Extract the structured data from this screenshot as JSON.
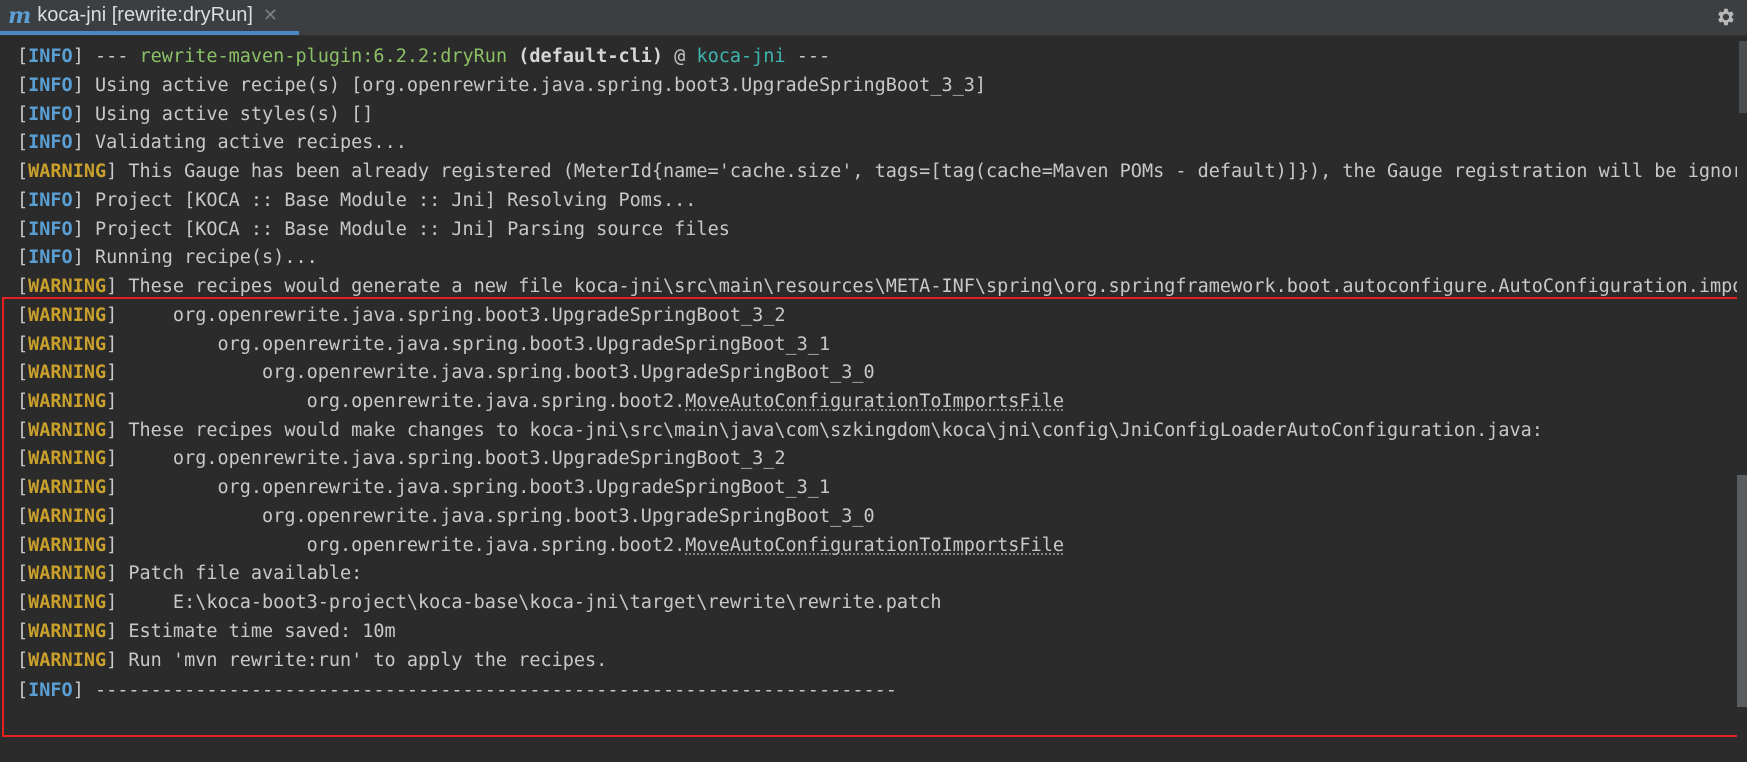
{
  "tab": {
    "logo": "m",
    "label": "koca-jni [rewrite:dryRun]",
    "close": "✕"
  },
  "toolbar": {
    "settings_icon": "gear-icon"
  },
  "console": {
    "l0": {
      "pre": "] --- ",
      "plugin": "rewrite-maven-plugin:6.2.2:dryRun",
      "mid": " ",
      "goal": "(default-cli)",
      "at": " @ ",
      "project": "koca-jni",
      "post": " ---"
    },
    "l1": "] Using active recipe(s) [org.openrewrite.java.spring.boot3.UpgradeSpringBoot_3_3]",
    "l2": "] Using active styles(s) []",
    "l3": "] Validating active recipes...",
    "l4": "] This Gauge has been already registered (MeterId{name='cache.size', tags=[tag(cache=Maven POMs - default)]}), the Gauge registration will be ignored.",
    "l5": "] Project [KOCA :: Base Module :: Jni] Resolving Poms...",
    "l6": "] Project [KOCA :: Base Module :: Jni] Parsing source files",
    "l7": "] Running recipe(s)...",
    "l8": "] These recipes would generate a new file koca-jni\\src\\main\\resources\\META-INF\\spring\\org.springframework.boot.autoconfigure.AutoConfiguration.imports:",
    "l9": "]     org.openrewrite.java.spring.boot3.UpgradeSpringBoot_3_2",
    "l10": "]         org.openrewrite.java.spring.boot3.UpgradeSpringBoot_3_1",
    "l11": "]             org.openrewrite.java.spring.boot3.UpgradeSpringBoot_3_0",
    "l12": {
      "pre": "]                 org.openrewrite.java.spring.boot2.",
      "link": "MoveAutoConfigurationToImportsFile"
    },
    "l13": "] These recipes would make changes to koca-jni\\src\\main\\java\\com\\szkingdom\\koca\\jni\\config\\JniConfigLoaderAutoConfiguration.java:",
    "l14": "]     org.openrewrite.java.spring.boot3.UpgradeSpringBoot_3_2",
    "l15": "]         org.openrewrite.java.spring.boot3.UpgradeSpringBoot_3_1",
    "l16": "]             org.openrewrite.java.spring.boot3.UpgradeSpringBoot_3_0",
    "l17": {
      "pre": "]                 org.openrewrite.java.spring.boot2.",
      "link": "MoveAutoConfigurationToImportsFile"
    },
    "l18": "] Patch file available:",
    "l19": "]     E:\\koca-boot3-project\\koca-base\\koca-jni\\target\\rewrite\\rewrite.patch",
    "l20": "] Estimate time saved: 10m",
    "l21": "] Run 'mvn rewrite:run' to apply the recipes.",
    "l22": "] ------------------------------------------------------------------------"
  },
  "levels": {
    "info": "INFO",
    "warn": "WARNING",
    "open": "["
  },
  "colors": {
    "background": "#2b2b2b",
    "info": "#5a9fd4",
    "warning": "#c9a02c",
    "plugin": "#8cc066",
    "project": "#3fb6b0",
    "highlight_border": "#e52020",
    "tab_underline": "#4a88c7"
  }
}
